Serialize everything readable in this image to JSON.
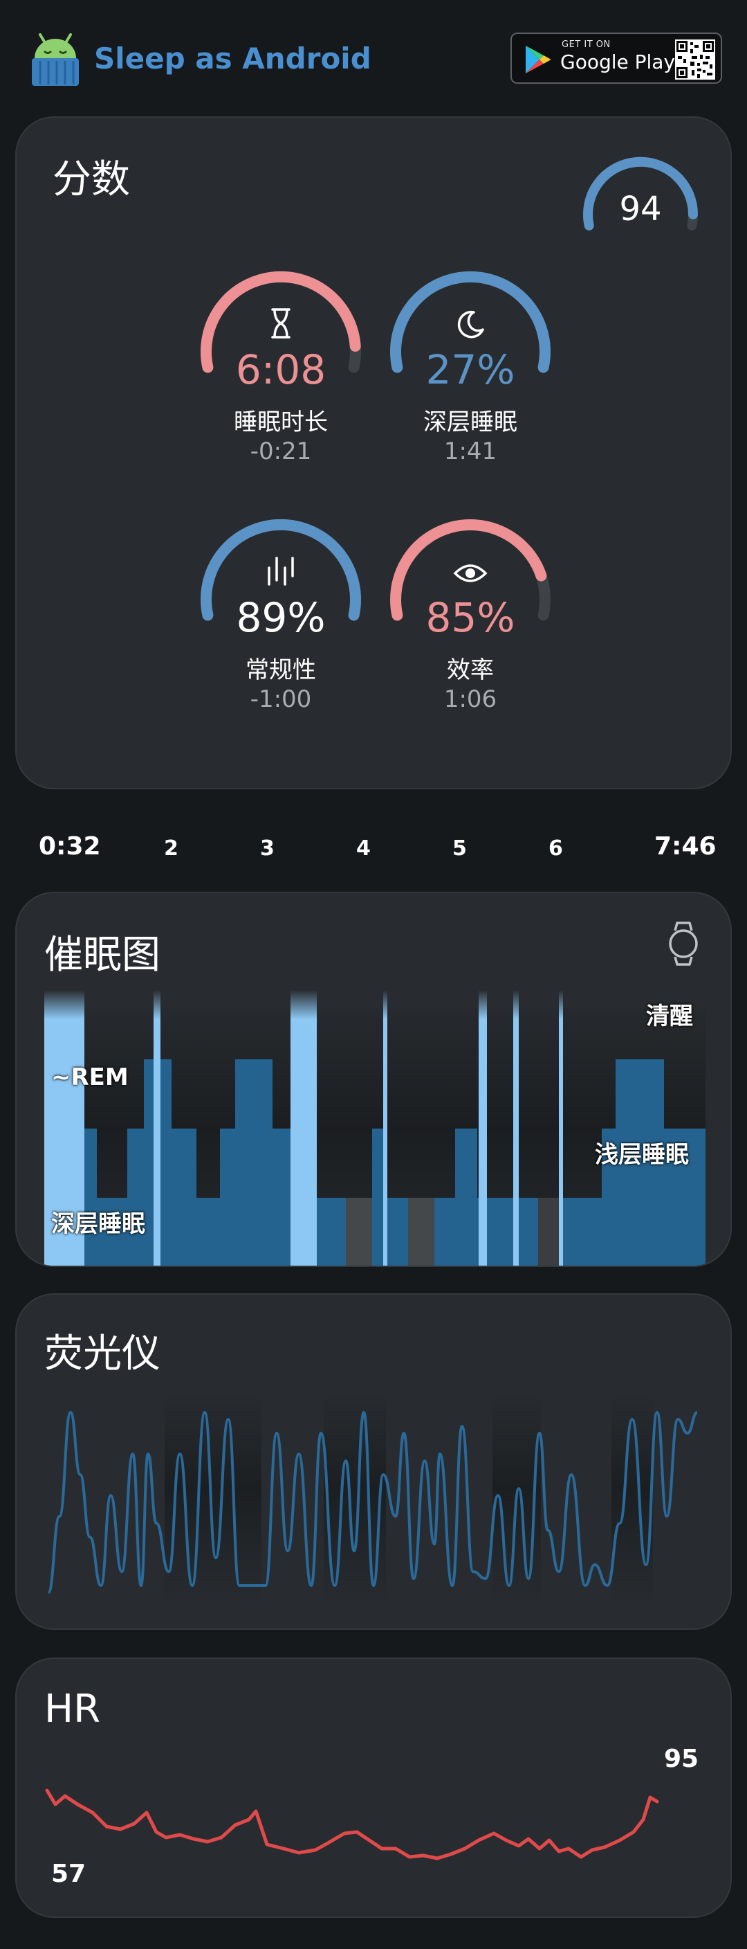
{
  "app": {
    "title": "Sleep as Android",
    "logo_icon": "android-sleep-logo",
    "badge_top": "GET IT ON",
    "badge_main": "Google Play"
  },
  "score": {
    "title": "分数",
    "total": "94",
    "total_fraction": 0.94,
    "gauges": [
      {
        "value": "6:08",
        "label": "睡眠时长",
        "sub": "-0:21",
        "icon": "hourglass-icon",
        "color": "#ee9194",
        "fill": 0.92
      },
      {
        "value": "27%",
        "label": "深层睡眠",
        "sub": "1:41",
        "icon": "moon-icon",
        "color": "#5b93c7",
        "fill": 1.0
      },
      {
        "value": "89%",
        "label": "常规性",
        "sub": "-1:00",
        "icon": "regularity-icon",
        "color": "#5b93c7",
        "fill": 1.0
      },
      {
        "value": "85%",
        "label": "效率",
        "sub": "1:06",
        "icon": "eye-icon",
        "color": "#ee9194",
        "fill": 0.85
      }
    ]
  },
  "timeline": {
    "start": "0:32",
    "hours": [
      "2",
      "3",
      "4",
      "5",
      "6"
    ],
    "end": "7:46"
  },
  "hypnogram": {
    "title": "催眠图",
    "watch_icon": "watch-icon",
    "awake_label": "清醒",
    "rem_label": "~REM",
    "light_label": "浅层睡眠",
    "deep_label": "深层睡眠"
  },
  "actigraph": {
    "title": "荧光仪"
  },
  "heart_rate": {
    "title": "HR",
    "max": "95",
    "min": "57"
  },
  "colors": {
    "accent_blue": "#4a8fd0",
    "pink": "#ee9194",
    "gauge_blue": "#5b93c7",
    "card_bg": "#282c30",
    "hr_line": "#e04a4a",
    "hyp_blue": "#24638f",
    "hyp_light": "#8cc8f3"
  }
}
